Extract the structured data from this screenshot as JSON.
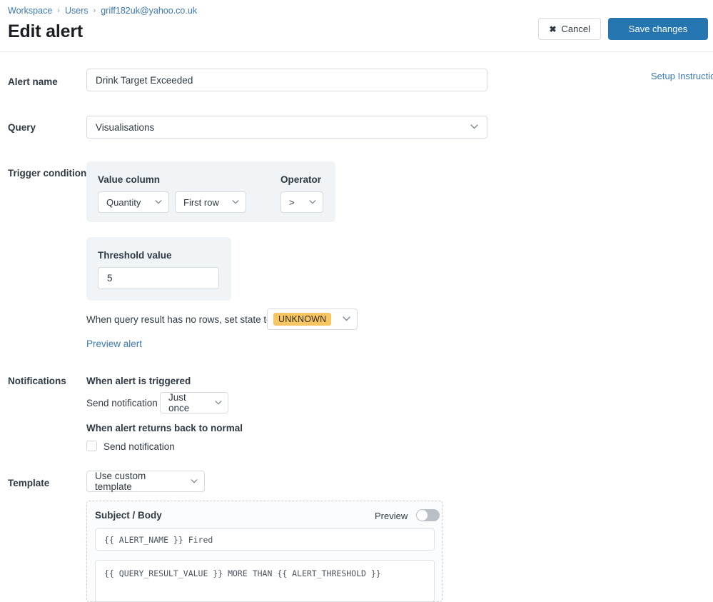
{
  "breadcrumb": {
    "items": [
      "Workspace",
      "Users",
      "griff182uk@yahoo.co.uk"
    ],
    "separator": "›"
  },
  "header": {
    "title": "Edit alert",
    "cancel_label": "Cancel",
    "cancel_icon": "✖",
    "save_label": "Save changes",
    "save_color": "#2575b0"
  },
  "setup_link": "Setup Instructions",
  "alert_name": {
    "label": "Alert name",
    "value": "Drink Target Exceeded"
  },
  "query": {
    "label": "Query",
    "value": "Visualisations"
  },
  "trigger": {
    "label": "Trigger condition",
    "value_column": {
      "title": "Value column",
      "column": "Quantity",
      "aggregation": "First row"
    },
    "operator": {
      "title": "Operator",
      "value": ">"
    },
    "threshold": {
      "title": "Threshold value",
      "value": "5"
    },
    "no_rows_text": "When query result has no rows, set state to",
    "no_rows_state": "UNKNOWN",
    "no_rows_state_color": "#f8c661",
    "preview_link": "Preview alert"
  },
  "notifications": {
    "label": "Notifications",
    "triggered_heading": "When alert is triggered",
    "send_notification_label": "Send notification",
    "frequency": "Just once",
    "normal_heading": "When alert returns back to normal",
    "normal_send_label": "Send notification",
    "normal_send_checked": false
  },
  "template": {
    "label": "Template",
    "mode": "Use custom template",
    "panel_heading": "Subject / Body",
    "preview_label": "Preview",
    "preview_enabled": false,
    "subject": "{{ ALERT_NAME }} Fired",
    "body": "{{ QUERY_RESULT_VALUE }} MORE THAN {{ ALERT_THRESHOLD }}"
  },
  "icons": {
    "chevron_down": "⌄"
  }
}
